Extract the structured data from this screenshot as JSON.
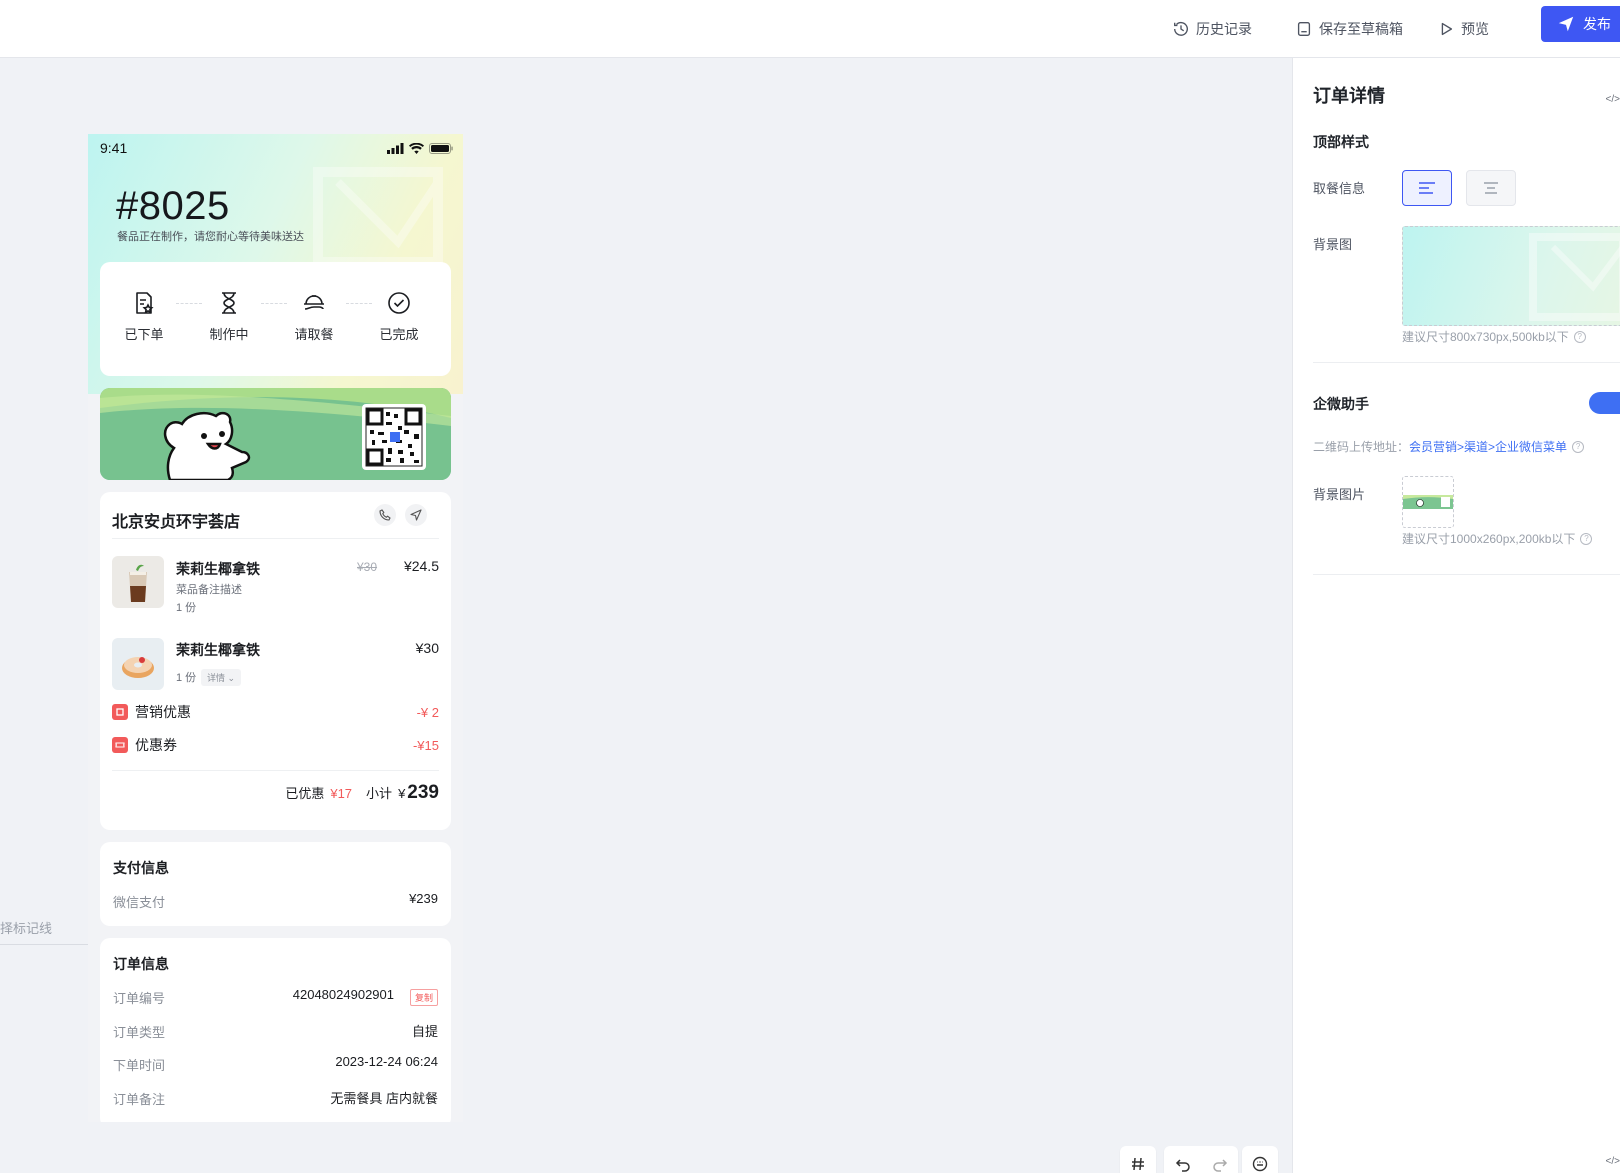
{
  "toolbar": {
    "history": "历史记录",
    "save_draft": "保存至草稿箱",
    "preview": "预览",
    "publish": "发布"
  },
  "canvas": {
    "left_hint": "择标记线"
  },
  "phone": {
    "time": "9:41",
    "order_number": "#8025",
    "order_status_text": "餐品正在制作，请您耐心等待美味送达",
    "steps": [
      "已下单",
      "制作中",
      "请取餐",
      "已完成"
    ],
    "store_name": "北京安贞环宇荟店",
    "items": [
      {
        "name": "茉莉生椰拿铁",
        "note": "菜品备注描述",
        "qty": "1 份",
        "price_old": "¥30",
        "price": "¥24.5"
      },
      {
        "name": "茉莉生椰拿铁",
        "qty": "1 份",
        "detail": "详情",
        "price": "¥30"
      }
    ],
    "discounts": [
      {
        "label": "营销优惠",
        "value": "-¥ 2"
      },
      {
        "label": "优惠券",
        "value": "-¥15"
      }
    ],
    "total": {
      "saved_label": "已优惠",
      "saved_value": "¥17",
      "subtotal_label": "小计",
      "currency": "¥",
      "subtotal_value": "239"
    },
    "payment": {
      "title": "支付信息",
      "method": "微信支付",
      "amount": "¥239"
    },
    "order_info": {
      "title": "订单信息",
      "rows": [
        {
          "label": "订单编号",
          "value": "42048024902901",
          "action": "复制"
        },
        {
          "label": "订单类型",
          "value": "自提"
        },
        {
          "label": "下单时间",
          "value": "2023-12-24 06:24"
        },
        {
          "label": "订单备注",
          "value": "无需餐具 店内就餐"
        }
      ]
    }
  },
  "panel": {
    "title": "订单详情",
    "code_icon": "</>",
    "top_style": "顶部样式",
    "pickup_info": "取餐信息",
    "bg_image": "背景图",
    "bg_hint": "建议尺寸800x730px,500kb以下",
    "wecom": "企微助手",
    "qr_label": "二维码上传地址：",
    "qr_link": "会员营销>渠道>企业微信菜单",
    "bg_picture": "背景图片",
    "bg_picture_hint": "建议尺寸1000x260px,200kb以下",
    "toggle_on": true
  },
  "colors": {
    "accent": "#3e57f3",
    "link": "#3e6ff3",
    "discount": "#f25a5a"
  }
}
